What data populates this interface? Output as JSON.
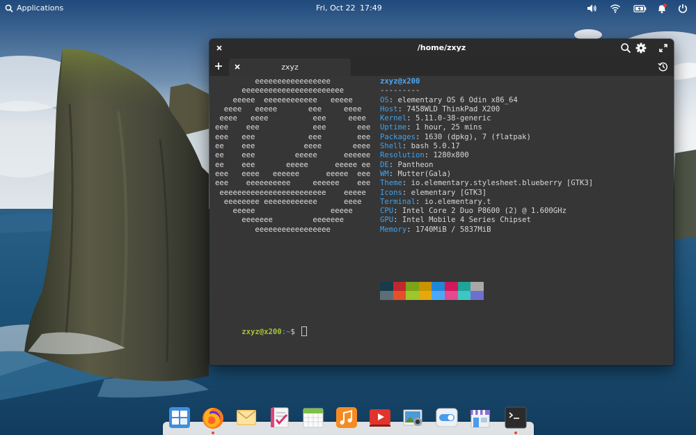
{
  "top_panel": {
    "applications_label": "Applications",
    "date": "Fri, Oct 22",
    "time": "17:49",
    "tray": [
      "volume-icon",
      "wifi-icon",
      "battery-icon",
      "notifications-icon",
      "power-icon"
    ]
  },
  "window": {
    "title": "/home/zxyz",
    "tab_label": "zxyz"
  },
  "terminal": {
    "ascii_logo": "         eeeeeeeeeeeeeeeee\n      eeeeeeeeeeeeeeeeeeeeeee\n    eeeee  eeeeeeeeeeee   eeeee\n  eeee   eeeee       eee     eeee\n eeee   eeee          eee     eeee\neee    eee            eee       eee\neee   eee            eee        eee\nee    eee           eeee       eeee\nee    eee         eeeee      eeeeee\nee    eee       eeeee      eeeee ee\neee   eeee   eeeeee      eeeee  eee\neee    eeeeeeeeee     eeeeee    eee\n eeeeeeeeeeeeeeeeeeeeeeee    eeeee\n  eeeeeeee eeeeeeeeeeee      eeee\n    eeeee                 eeeee\n      eeeeeee         eeeeeee\n         eeeeeeeeeeeeeeeee",
    "user_host": "zxyz@x200",
    "separator": "---------",
    "info": [
      {
        "key": "OS",
        "value": "elementary OS 6 Odin x86_64"
      },
      {
        "key": "Host",
        "value": "7458WLD ThinkPad X200"
      },
      {
        "key": "Kernel",
        "value": "5.11.0-38-generic"
      },
      {
        "key": "Uptime",
        "value": "1 hour, 25 mins"
      },
      {
        "key": "Packages",
        "value": "1630 (dpkg), 7 (flatpak)"
      },
      {
        "key": "Shell",
        "value": "bash 5.0.17"
      },
      {
        "key": "Resolution",
        "value": "1280x800"
      },
      {
        "key": "DE",
        "value": "Pantheon"
      },
      {
        "key": "WM",
        "value": "Mutter(Gala)"
      },
      {
        "key": "Theme",
        "value": "io.elementary.stylesheet.blueberry [GTK3]"
      },
      {
        "key": "Icons",
        "value": "elementary [GTK3]"
      },
      {
        "key": "Terminal",
        "value": "io.elementary.t"
      },
      {
        "key": "CPU",
        "value": "Intel Core 2 Duo P8600 (2) @ 1.600GHz"
      },
      {
        "key": "GPU",
        "value": "Intel Mobile 4 Series Chipset"
      },
      {
        "key": "Memory",
        "value": "1740MiB / 5837MiB"
      }
    ],
    "palette": [
      "#173b48",
      "#c2272d",
      "#7da319",
      "#c89400",
      "#1f87d6",
      "#d1185b",
      "#20a39b",
      "#a8a8a8",
      "#5e6e76",
      "#e2512a",
      "#9dc72a",
      "#e5a90d",
      "#4ba8f5",
      "#e5498e",
      "#3cc8c0",
      "#6f6fd0"
    ],
    "prompt_user_host": "zxyz@x200",
    "prompt_path": ":~",
    "prompt_symbol": "$ "
  },
  "dock": {
    "items": [
      {
        "name": "multitasking-view-icon"
      },
      {
        "name": "firefox-icon"
      },
      {
        "name": "mail-icon"
      },
      {
        "name": "tasks-icon"
      },
      {
        "name": "calendar-icon"
      },
      {
        "name": "music-icon"
      },
      {
        "name": "videos-icon"
      },
      {
        "name": "photos-icon"
      },
      {
        "name": "settings-icon"
      },
      {
        "name": "appcenter-icon"
      },
      {
        "name": "terminal-icon"
      }
    ]
  }
}
